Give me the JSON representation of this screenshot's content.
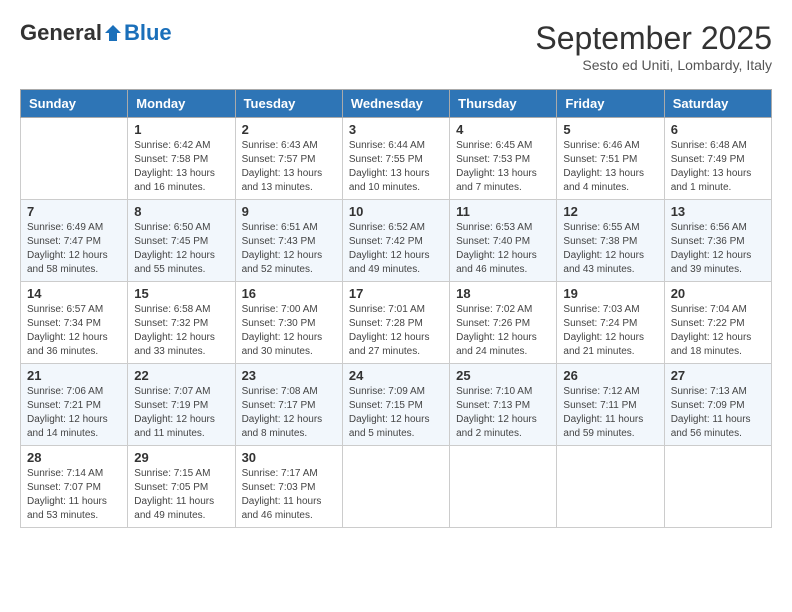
{
  "header": {
    "logo": {
      "general": "General",
      "blue": "Blue"
    },
    "title": "September 2025",
    "subtitle": "Sesto ed Uniti, Lombardy, Italy"
  },
  "weekdays": [
    "Sunday",
    "Monday",
    "Tuesday",
    "Wednesday",
    "Thursday",
    "Friday",
    "Saturday"
  ],
  "weeks": [
    [
      null,
      {
        "day": "1",
        "sunrise": "Sunrise: 6:42 AM",
        "sunset": "Sunset: 7:58 PM",
        "daylight": "Daylight: 13 hours and 16 minutes."
      },
      {
        "day": "2",
        "sunrise": "Sunrise: 6:43 AM",
        "sunset": "Sunset: 7:57 PM",
        "daylight": "Daylight: 13 hours and 13 minutes."
      },
      {
        "day": "3",
        "sunrise": "Sunrise: 6:44 AM",
        "sunset": "Sunset: 7:55 PM",
        "daylight": "Daylight: 13 hours and 10 minutes."
      },
      {
        "day": "4",
        "sunrise": "Sunrise: 6:45 AM",
        "sunset": "Sunset: 7:53 PM",
        "daylight": "Daylight: 13 hours and 7 minutes."
      },
      {
        "day": "5",
        "sunrise": "Sunrise: 6:46 AM",
        "sunset": "Sunset: 7:51 PM",
        "daylight": "Daylight: 13 hours and 4 minutes."
      },
      {
        "day": "6",
        "sunrise": "Sunrise: 6:48 AM",
        "sunset": "Sunset: 7:49 PM",
        "daylight": "Daylight: 13 hours and 1 minute."
      }
    ],
    [
      {
        "day": "7",
        "sunrise": "Sunrise: 6:49 AM",
        "sunset": "Sunset: 7:47 PM",
        "daylight": "Daylight: 12 hours and 58 minutes."
      },
      {
        "day": "8",
        "sunrise": "Sunrise: 6:50 AM",
        "sunset": "Sunset: 7:45 PM",
        "daylight": "Daylight: 12 hours and 55 minutes."
      },
      {
        "day": "9",
        "sunrise": "Sunrise: 6:51 AM",
        "sunset": "Sunset: 7:43 PM",
        "daylight": "Daylight: 12 hours and 52 minutes."
      },
      {
        "day": "10",
        "sunrise": "Sunrise: 6:52 AM",
        "sunset": "Sunset: 7:42 PM",
        "daylight": "Daylight: 12 hours and 49 minutes."
      },
      {
        "day": "11",
        "sunrise": "Sunrise: 6:53 AM",
        "sunset": "Sunset: 7:40 PM",
        "daylight": "Daylight: 12 hours and 46 minutes."
      },
      {
        "day": "12",
        "sunrise": "Sunrise: 6:55 AM",
        "sunset": "Sunset: 7:38 PM",
        "daylight": "Daylight: 12 hours and 43 minutes."
      },
      {
        "day": "13",
        "sunrise": "Sunrise: 6:56 AM",
        "sunset": "Sunset: 7:36 PM",
        "daylight": "Daylight: 12 hours and 39 minutes."
      }
    ],
    [
      {
        "day": "14",
        "sunrise": "Sunrise: 6:57 AM",
        "sunset": "Sunset: 7:34 PM",
        "daylight": "Daylight: 12 hours and 36 minutes."
      },
      {
        "day": "15",
        "sunrise": "Sunrise: 6:58 AM",
        "sunset": "Sunset: 7:32 PM",
        "daylight": "Daylight: 12 hours and 33 minutes."
      },
      {
        "day": "16",
        "sunrise": "Sunrise: 7:00 AM",
        "sunset": "Sunset: 7:30 PM",
        "daylight": "Daylight: 12 hours and 30 minutes."
      },
      {
        "day": "17",
        "sunrise": "Sunrise: 7:01 AM",
        "sunset": "Sunset: 7:28 PM",
        "daylight": "Daylight: 12 hours and 27 minutes."
      },
      {
        "day": "18",
        "sunrise": "Sunrise: 7:02 AM",
        "sunset": "Sunset: 7:26 PM",
        "daylight": "Daylight: 12 hours and 24 minutes."
      },
      {
        "day": "19",
        "sunrise": "Sunrise: 7:03 AM",
        "sunset": "Sunset: 7:24 PM",
        "daylight": "Daylight: 12 hours and 21 minutes."
      },
      {
        "day": "20",
        "sunrise": "Sunrise: 7:04 AM",
        "sunset": "Sunset: 7:22 PM",
        "daylight": "Daylight: 12 hours and 18 minutes."
      }
    ],
    [
      {
        "day": "21",
        "sunrise": "Sunrise: 7:06 AM",
        "sunset": "Sunset: 7:21 PM",
        "daylight": "Daylight: 12 hours and 14 minutes."
      },
      {
        "day": "22",
        "sunrise": "Sunrise: 7:07 AM",
        "sunset": "Sunset: 7:19 PM",
        "daylight": "Daylight: 12 hours and 11 minutes."
      },
      {
        "day": "23",
        "sunrise": "Sunrise: 7:08 AM",
        "sunset": "Sunset: 7:17 PM",
        "daylight": "Daylight: 12 hours and 8 minutes."
      },
      {
        "day": "24",
        "sunrise": "Sunrise: 7:09 AM",
        "sunset": "Sunset: 7:15 PM",
        "daylight": "Daylight: 12 hours and 5 minutes."
      },
      {
        "day": "25",
        "sunrise": "Sunrise: 7:10 AM",
        "sunset": "Sunset: 7:13 PM",
        "daylight": "Daylight: 12 hours and 2 minutes."
      },
      {
        "day": "26",
        "sunrise": "Sunrise: 7:12 AM",
        "sunset": "Sunset: 7:11 PM",
        "daylight": "Daylight: 11 hours and 59 minutes."
      },
      {
        "day": "27",
        "sunrise": "Sunrise: 7:13 AM",
        "sunset": "Sunset: 7:09 PM",
        "daylight": "Daylight: 11 hours and 56 minutes."
      }
    ],
    [
      {
        "day": "28",
        "sunrise": "Sunrise: 7:14 AM",
        "sunset": "Sunset: 7:07 PM",
        "daylight": "Daylight: 11 hours and 53 minutes."
      },
      {
        "day": "29",
        "sunrise": "Sunrise: 7:15 AM",
        "sunset": "Sunset: 7:05 PM",
        "daylight": "Daylight: 11 hours and 49 minutes."
      },
      {
        "day": "30",
        "sunrise": "Sunrise: 7:17 AM",
        "sunset": "Sunset: 7:03 PM",
        "daylight": "Daylight: 11 hours and 46 minutes."
      },
      null,
      null,
      null,
      null
    ]
  ]
}
